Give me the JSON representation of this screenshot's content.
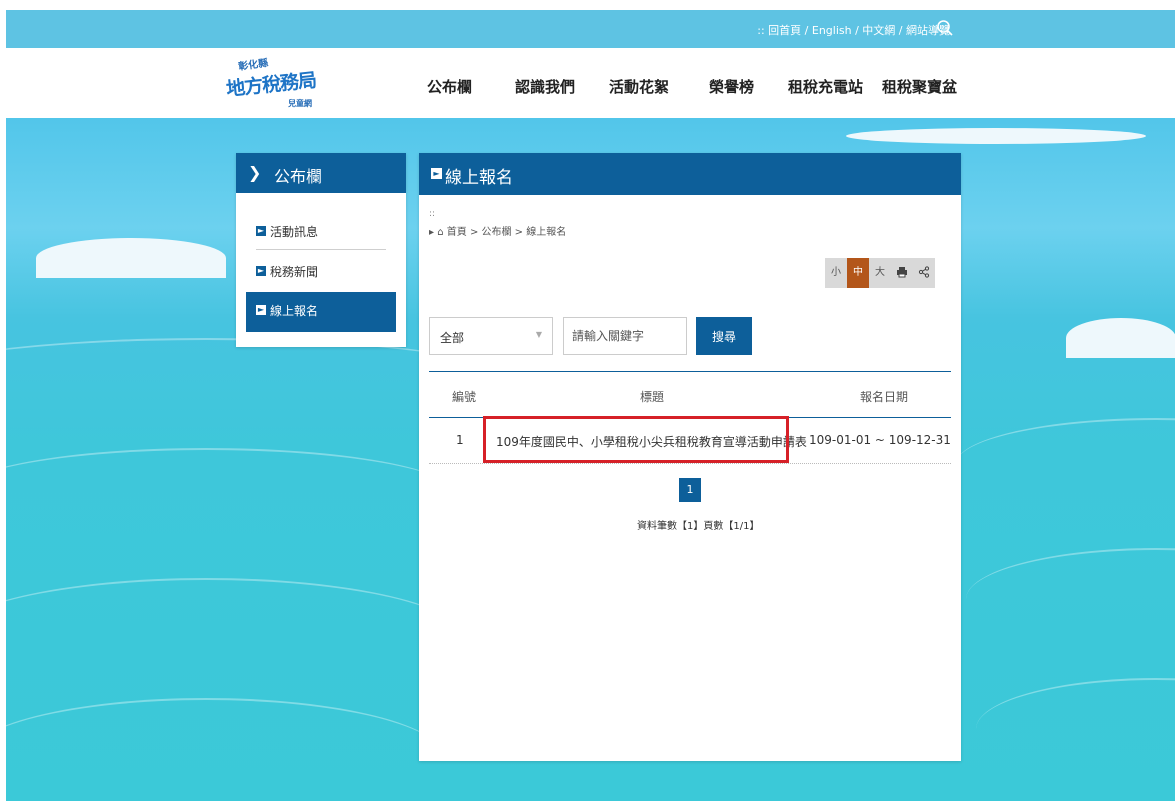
{
  "topbar": {
    "links": ":: 回首頁 / English / 中文網 / 網站導覽"
  },
  "logo": {
    "line1": "彰化縣",
    "line2": "地方稅務局",
    "line3": "兒童網"
  },
  "nav": [
    "公布欄",
    "認識我們",
    "活動花絮",
    "榮譽榜",
    "租稅充電站",
    "租稅聚寶盆"
  ],
  "sidebar": {
    "title": "公布欄",
    "items": [
      {
        "label": "活動訊息"
      },
      {
        "label": "稅務新聞"
      },
      {
        "label": "線上報名"
      }
    ]
  },
  "main": {
    "title": "線上報名",
    "dots": "::",
    "breadcrumb": "首頁 > 公布欄 > 線上報名",
    "font_sizes": [
      "小",
      "中",
      "大"
    ],
    "filter": {
      "selected": "全部",
      "placeholder": "請輸入關鍵字",
      "search_label": "搜尋"
    },
    "table": {
      "headers": [
        "編號",
        "標題",
        "報名日期"
      ],
      "rows": [
        {
          "no": "1",
          "title": "109年度國民中、小學租稅小尖兵租稅教育宣導活動申請表",
          "date": "109-01-01 ~ 109-12-31"
        }
      ]
    },
    "pagination": {
      "current": "1",
      "info": "資料筆數【1】頁數【1/1】"
    }
  },
  "colors": {
    "primary": "#0d5f9a",
    "topbar": "#5ec3e3",
    "highlight": "#d62027",
    "active_size": "#b3561a"
  }
}
